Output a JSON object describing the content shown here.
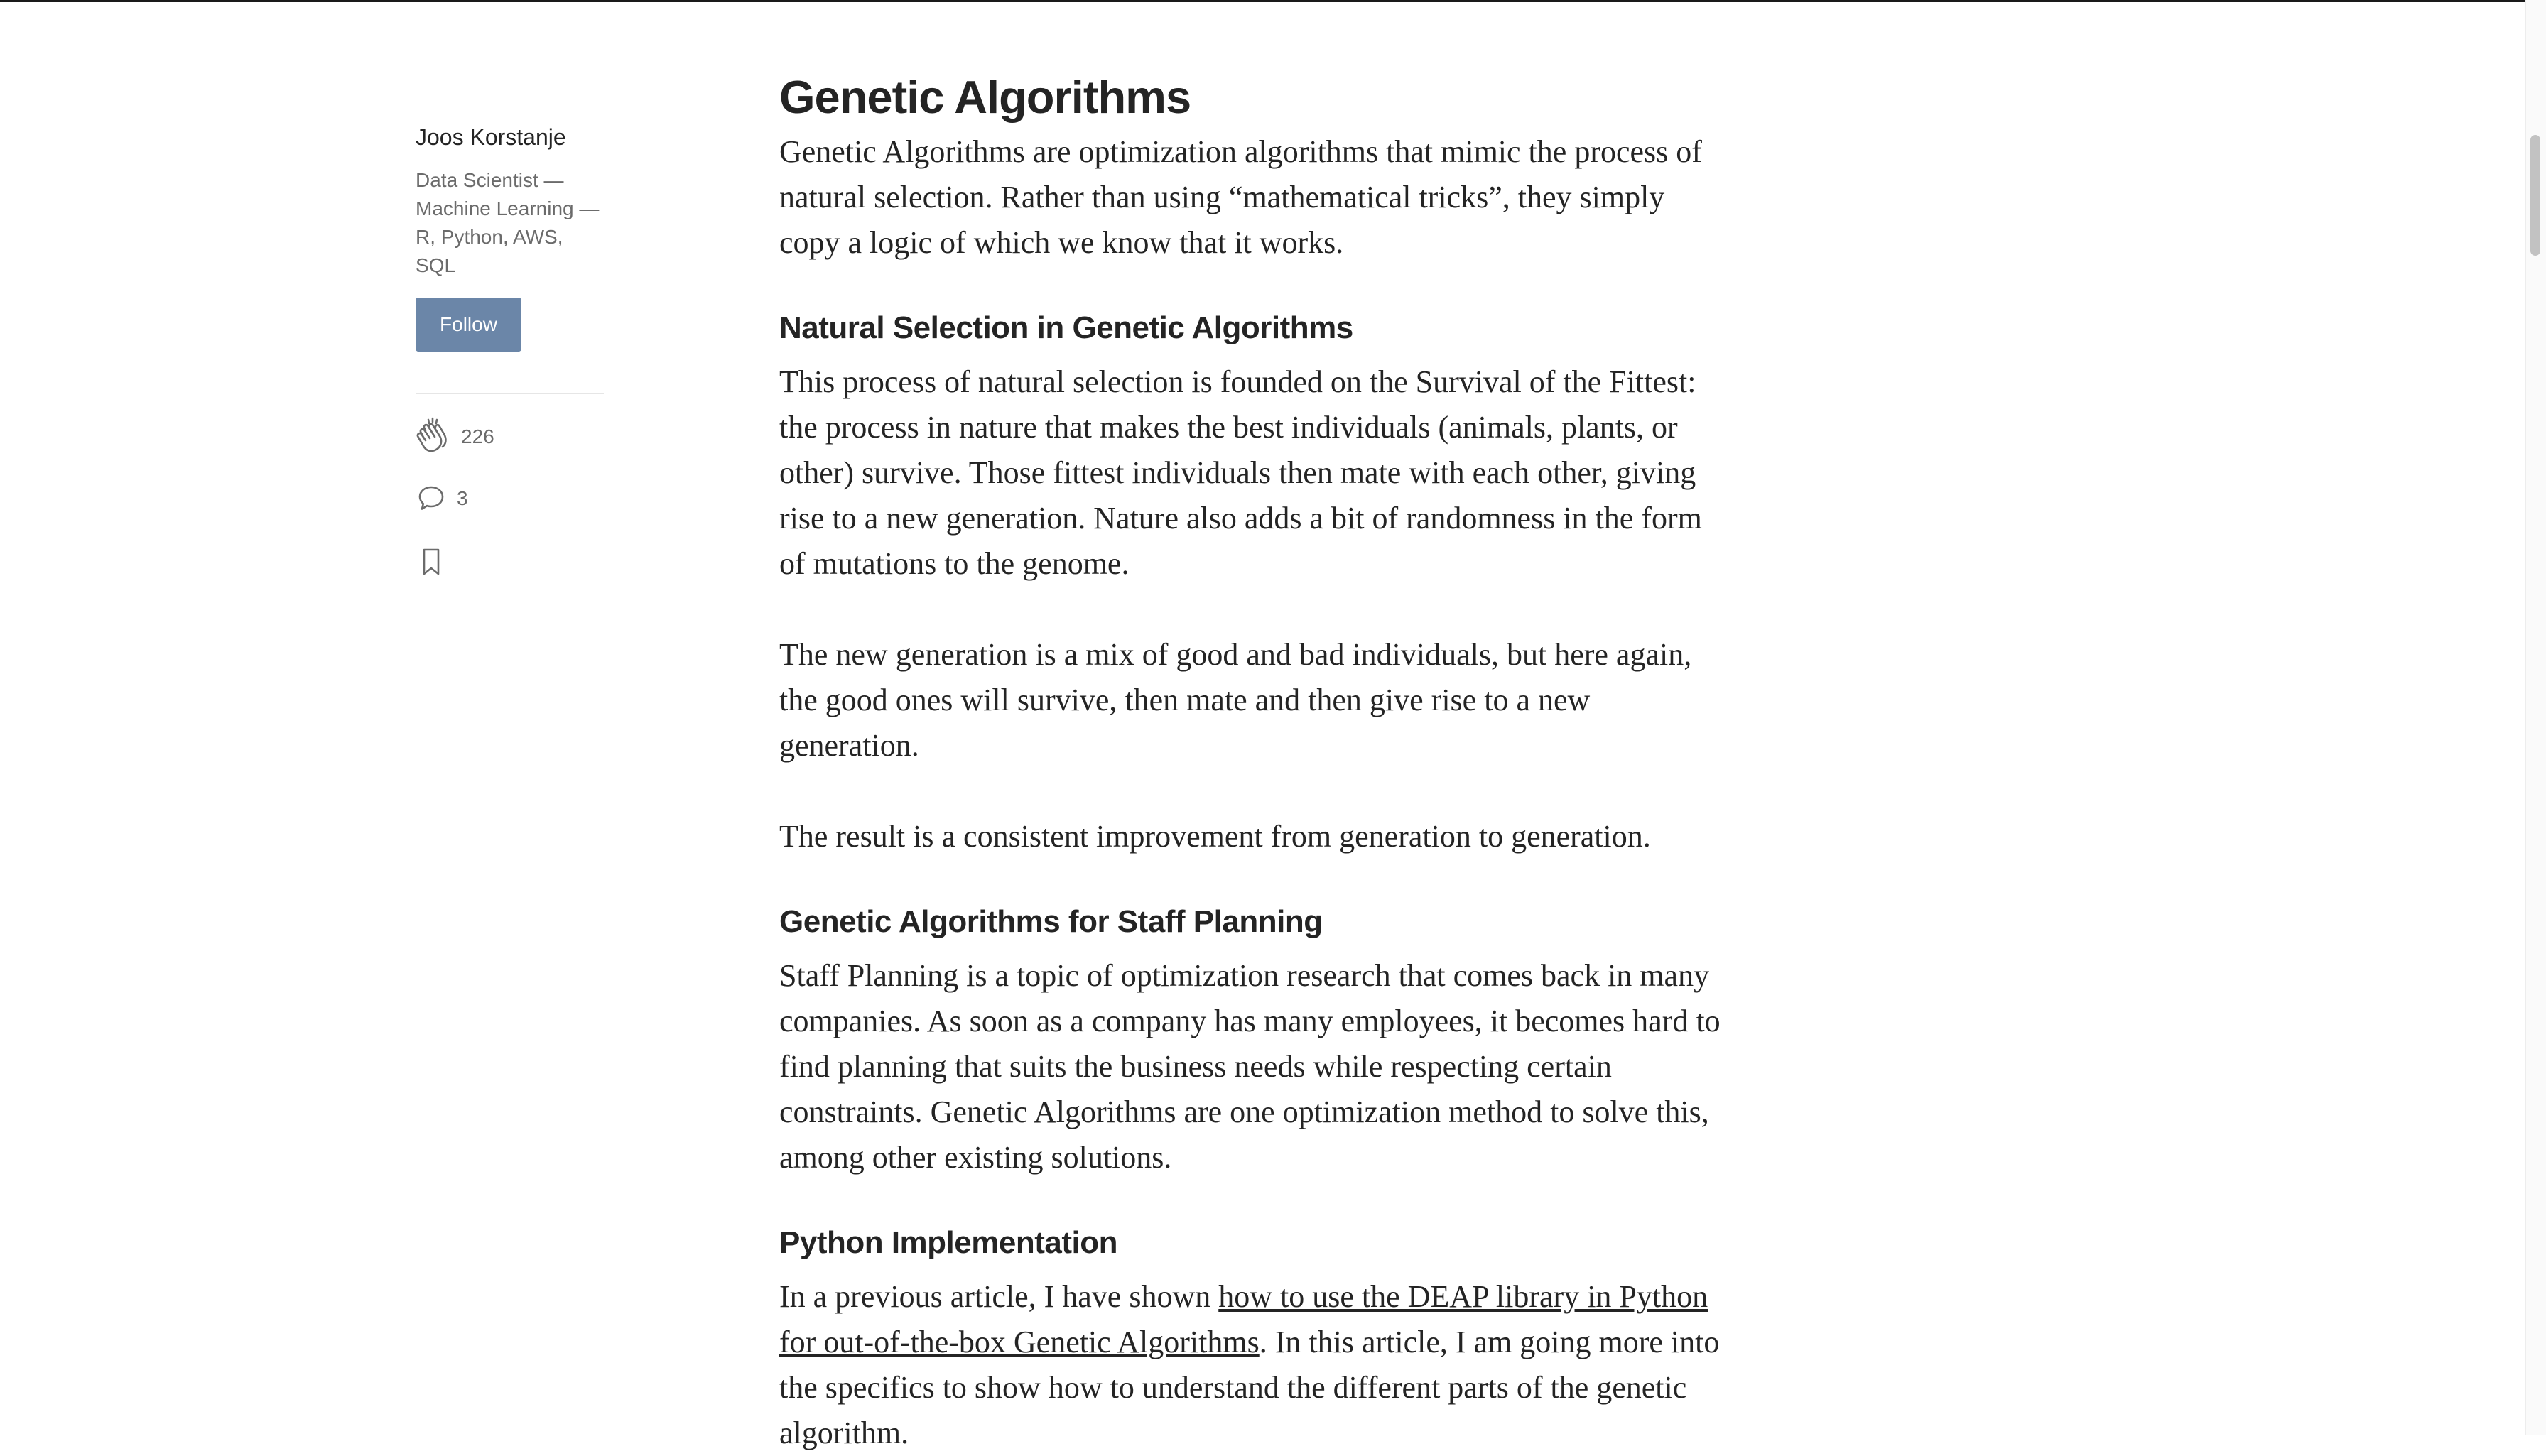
{
  "author": {
    "name": "Joos Korstanje",
    "bio": "Data Scientist — Machine Learning — R, Python, AWS, SQL",
    "follow_label": "Follow"
  },
  "stats": {
    "claps": "226",
    "responses": "3",
    "claps_icon": "clap-icon",
    "responses_icon": "comment-icon",
    "bookmark_icon": "bookmark-icon"
  },
  "article": {
    "title": "Genetic Algorithms",
    "intro": "Genetic Algorithms are optimization algorithms that mimic the process of natural selection. Rather than using “mathematical tricks”, they simply copy a logic of which we know that it works.",
    "section1": {
      "heading": "Natural Selection in Genetic Algorithms",
      "paragraphs": [
        "This process of natural selection is founded on the Survival of the Fittest: the process in nature that makes the best individuals (animals, plants, or other) survive. Those fittest individuals then mate with each other, giving rise to a new generation. Nature also adds a bit of randomness in the form of mutations to the genome.",
        "The new generation is a mix of good and bad individuals, but here again, the good ones will survive, then mate and then give rise to a new generation.",
        "The result is a consistent improvement from generation to generation."
      ]
    },
    "section2": {
      "heading": "Genetic Algorithms for Staff Planning",
      "paragraph": "Staff Planning is a topic of optimization research that comes back in many companies. As soon as a company has many employees, it becomes hard to find planning that suits the business needs while respecting certain constraints. Genetic Algorithms are one optimization method to solve this, among other existing solutions."
    },
    "section3": {
      "heading": "Python Implementation",
      "text_before_link": "In a previous article, I have shown ",
      "link_text": "how to use the DEAP library in Python for out-of-the-box Genetic Algorithms",
      "text_after_link": ". In this article, I am going more into the specifics to show how to understand the different parts of the genetic algorithm."
    }
  }
}
